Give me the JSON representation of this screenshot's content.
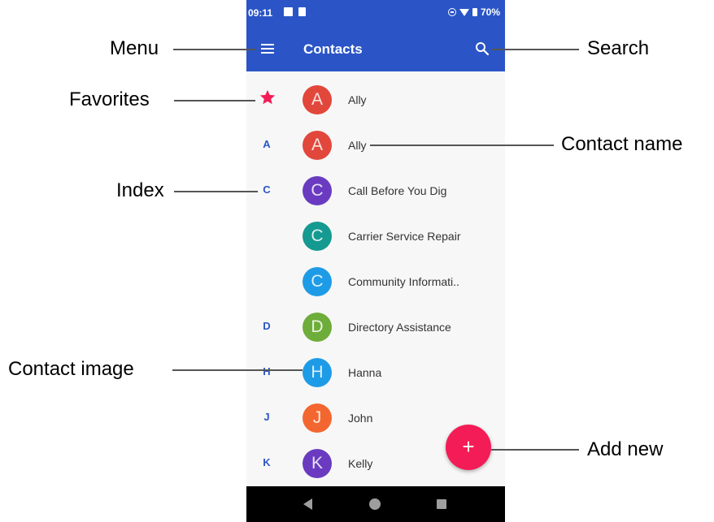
{
  "status_bar": {
    "time": "09:11",
    "battery": "70%"
  },
  "app_bar": {
    "title": "Contacts",
    "menu_icon": "menu-icon",
    "search_icon": "search-icon"
  },
  "contacts": [
    {
      "section": "★",
      "favorite": true,
      "initial": "A",
      "name": "Ally",
      "color": "#e2473b"
    },
    {
      "section": "A",
      "initial": "A",
      "name": "Ally",
      "color": "#e2473b"
    },
    {
      "section": "C",
      "initial": "C",
      "name": "Call Before You Dig",
      "color": "#6a3bc0"
    },
    {
      "section": "",
      "initial": "C",
      "name": "Carrier Service Repair",
      "color": "#149a90"
    },
    {
      "section": "",
      "initial": "C",
      "name": "Community Informati..",
      "color": "#1e9be6"
    },
    {
      "section": "D",
      "initial": "D",
      "name": "Directory Assistance",
      "color": "#6fad3a"
    },
    {
      "section": "H",
      "initial": "H",
      "name": "Hanna",
      "color": "#1e9be6"
    },
    {
      "section": "J",
      "initial": "J",
      "name": "John",
      "color": "#f4662f"
    },
    {
      "section": "K",
      "initial": "K",
      "name": "Kelly",
      "color": "#6a3bc0"
    }
  ],
  "fab": {
    "label": "+"
  },
  "callouts": {
    "menu": "Menu",
    "favorites": "Favorites",
    "index": "Index",
    "contact_image": "Contact image",
    "search": "Search",
    "contact_name": "Contact name",
    "add_new": "Add new"
  }
}
